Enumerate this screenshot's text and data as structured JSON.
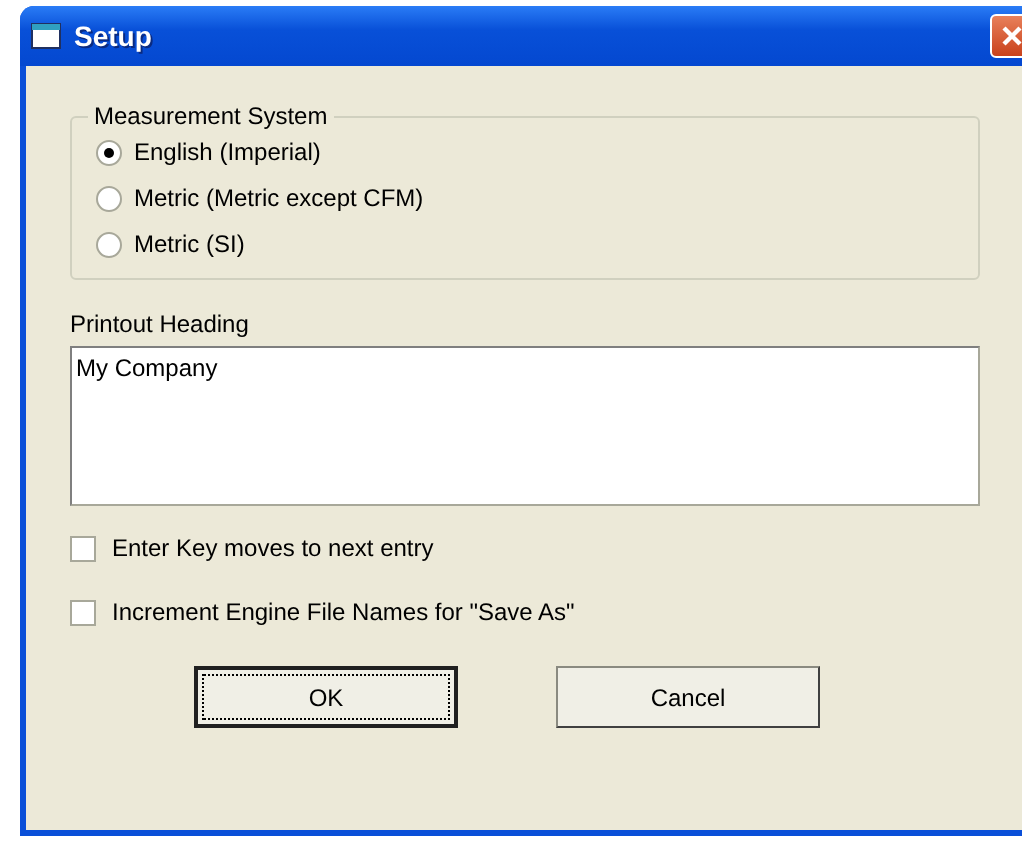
{
  "window": {
    "title": "Setup"
  },
  "measurement_system": {
    "label": "Measurement System",
    "options": [
      {
        "label": "English (Imperial)",
        "selected": true
      },
      {
        "label": "Metric (Metric except CFM)",
        "selected": false
      },
      {
        "label": "Metric (SI)",
        "selected": false
      }
    ]
  },
  "printout_heading": {
    "label": "Printout Heading",
    "value": "My Company"
  },
  "options": [
    {
      "label": "Enter Key moves to next entry",
      "checked": false
    },
    {
      "label": "Increment Engine File Names for \"Save As\"",
      "checked": false
    }
  ],
  "buttons": [
    {
      "label": "OK",
      "kind": "default"
    },
    {
      "label": "Cancel",
      "kind": "normal"
    }
  ]
}
